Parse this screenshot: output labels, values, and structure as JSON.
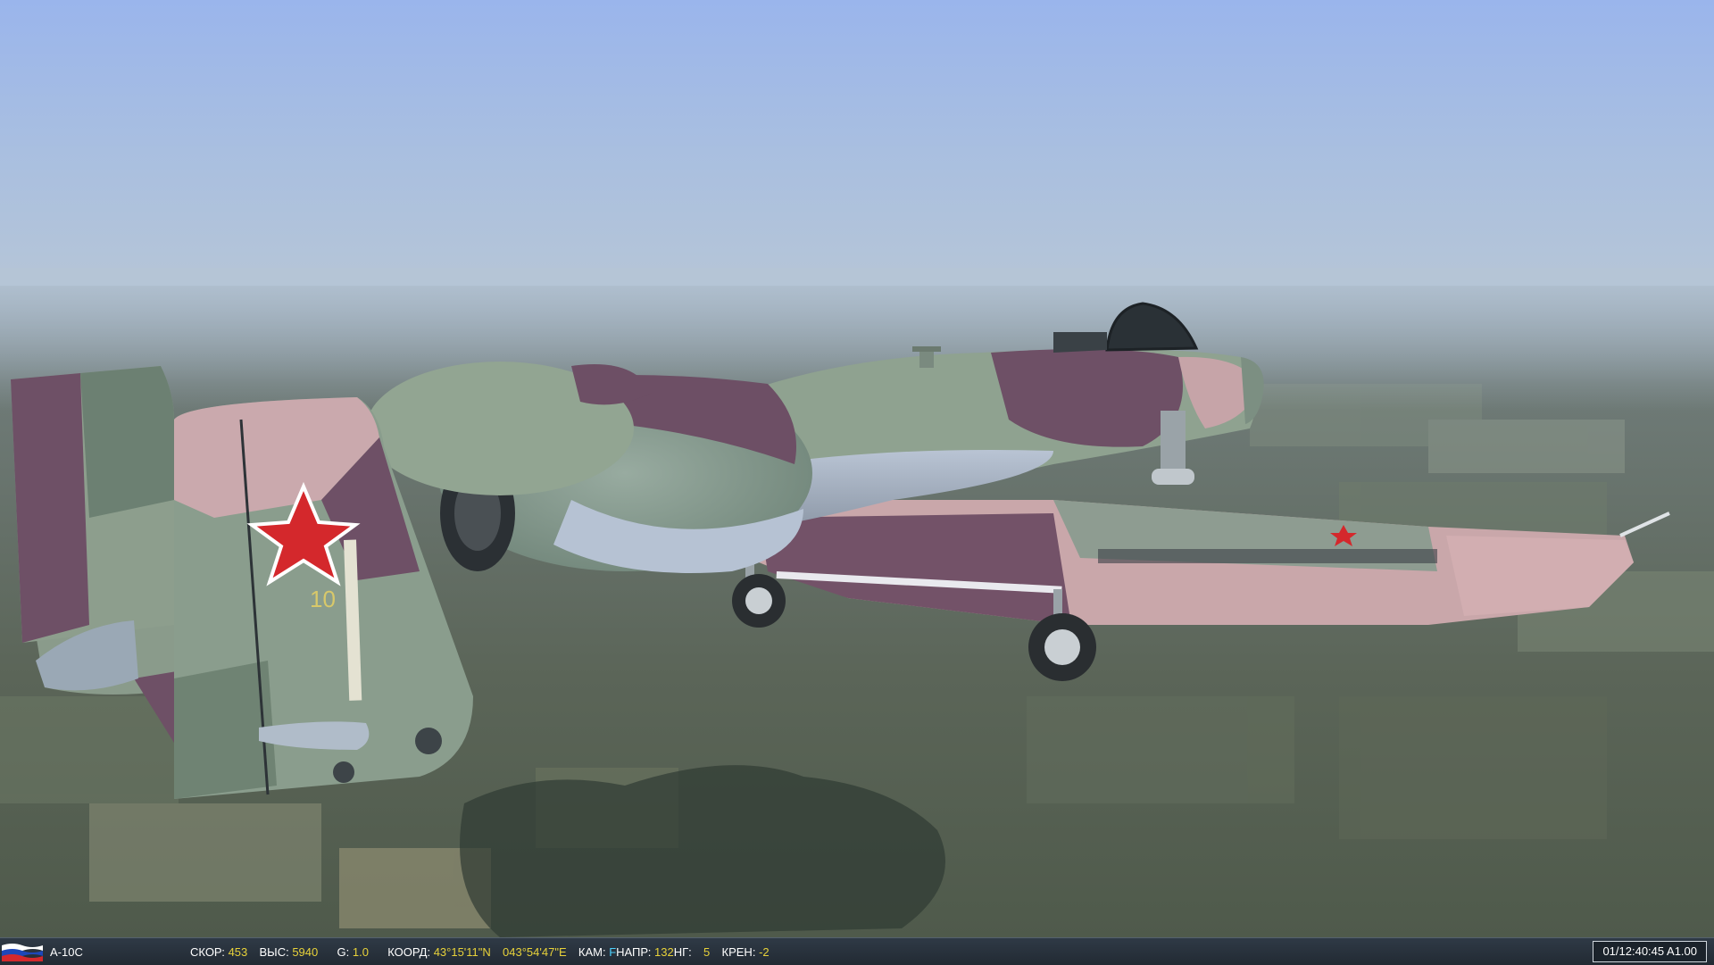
{
  "status_bar": {
    "flag_icon": "russia-flag-icon",
    "aircraft": "A-10C",
    "speed_label": "СКОР:",
    "speed_value": "453",
    "altitude_label": "ВЫС:",
    "altitude_value": "5940",
    "g_label": "G:",
    "g_value": "1.0",
    "coord_label": "КООРД:",
    "lat_value": "43°15'11\"N",
    "lon_value": "043°54'47\"E",
    "camera_label": "КАМ:",
    "camera_value": "F",
    "heading_label": "НАПР:",
    "heading_value": "132",
    "pitch_label": "НГ:",
    "pitch_value": "5",
    "roll_label": "КРЕН:",
    "roll_value": "-2",
    "clock": "01/12:40:45 A1.00"
  },
  "colors": {
    "sky_top": "#9bb4ea",
    "haze": "#b5c7dc",
    "ground": "#59645c",
    "camo_green": "#8a9c8a",
    "camo_pink": "#c7a3a6",
    "camo_purple": "#6e4f63",
    "star_red": "#d4282c",
    "hud_value": "#e8d23a"
  }
}
